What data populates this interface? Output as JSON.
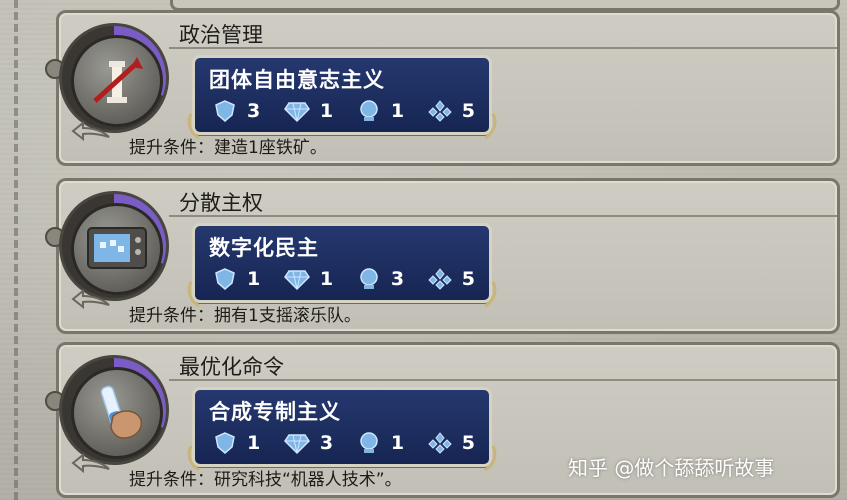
{
  "policies": [
    {
      "name": "政治管理",
      "icon": "torch-column-icon",
      "card_title": "团体自由意志主义",
      "stats": {
        "military": "3",
        "economic": "1",
        "diplomatic": "1",
        "wildcard": "5"
      },
      "condition": "提升条件：建造1座铁矿。"
    },
    {
      "name": "分散主权",
      "icon": "tv-screen-icon",
      "card_title": "数字化民主",
      "stats": {
        "military": "1",
        "economic": "1",
        "diplomatic": "3",
        "wildcard": "5"
      },
      "condition": "提升条件：拥有1支摇滚乐队。"
    },
    {
      "name": "最优化命令",
      "icon": "hand-vial-icon",
      "card_title": "合成专制主义",
      "stats": {
        "military": "1",
        "economic": "3",
        "diplomatic": "1",
        "wildcard": "5"
      },
      "condition": "提升条件：研究科技“机器人技术”。"
    }
  ],
  "watermark": "知乎 @做个舔舔听故事",
  "colors": {
    "card_bg": "#1c2d60",
    "card_border": "#d7d3c2",
    "progress_purple": "#7b5cc4",
    "icon_blue": "#7fb6e6"
  }
}
